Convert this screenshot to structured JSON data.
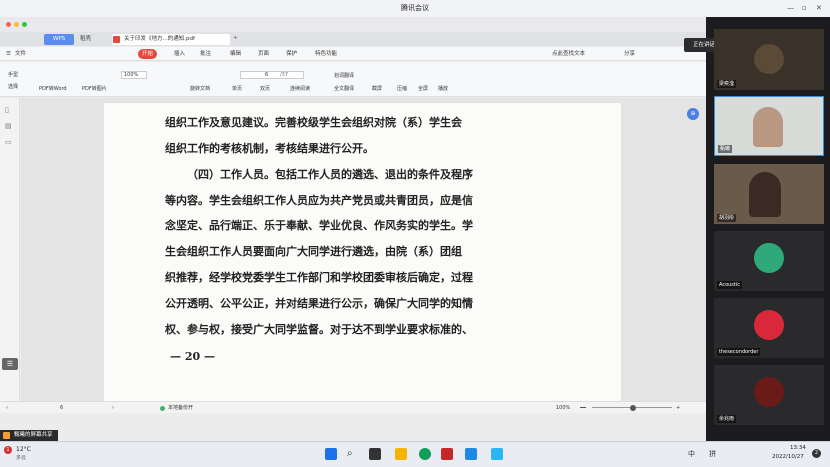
{
  "meeting": {
    "title": "腾讯会议",
    "speaking": "正在讲话: 甄曦;"
  },
  "wps": {
    "tabs": [
      "WPS",
      "稻壳",
      "关于印发《地方...的通知.pdf"
    ],
    "menu": [
      "文件",
      "开始",
      "插入",
      "批注",
      "编辑",
      "页面",
      "保护",
      "特色功能"
    ],
    "menu_right": [
      "点此查找文本",
      "分享"
    ],
    "toolbar": {
      "hand": "手型",
      "select": "选择",
      "pdf_word": "PDF转Word",
      "pdf_img": "PDF转图片",
      "zoom": "100%",
      "rotate": "旋转文档",
      "page_current": "6",
      "page_total": "/37",
      "single": "单页",
      "double": "双页",
      "continuous": "连续阅读",
      "translate_select": "划词翻译",
      "translate_full": "全文翻译",
      "screenshot": "截屏",
      "compress": "压缩",
      "fullscreen": "全屏",
      "play": "播放"
    },
    "doc_lines": [
      "组织工作及意见建议。完善校级学生会组织对院（系）学生会",
      "组织工作的考核机制，考核结果进行公开。",
      "（四）工作人员。包括工作人员的遴选、退出的条件及程序",
      "等内容。学生会组织工作人员应为共产党员或共青团员，应是信",
      "念坚定、品行端正、乐于奉献、学业优良、作风务实的学生。学",
      "生会组织工作人员要面向广大同学进行遴选，由院（系）团组",
      "织推荐，经学校党委学生工作部门和学校团委审核后确定，过程",
      "公开透明、公平公正，并对结果进行公示，确保广大同学的知情",
      "权、参与权，接受广大同学监督。对于达不到学业要求标准的、"
    ],
    "page_number": "— 20 —",
    "status": {
      "page": "6",
      "backup": "本地备份开",
      "zoom": "100%"
    }
  },
  "share_label": "甄曦的屏幕共享",
  "participants": [
    "梁奕滢",
    "甄曦",
    "胡羽彤",
    "Acoustic",
    "thesecondorder",
    "余兆雨"
  ],
  "taskbar": {
    "weather_temp": "12°C",
    "weather_desc": "多云",
    "badge": "1",
    "ime": "中",
    "ime2": "拼",
    "time": "13:34",
    "date": "2022/10/27",
    "notif": "2"
  }
}
